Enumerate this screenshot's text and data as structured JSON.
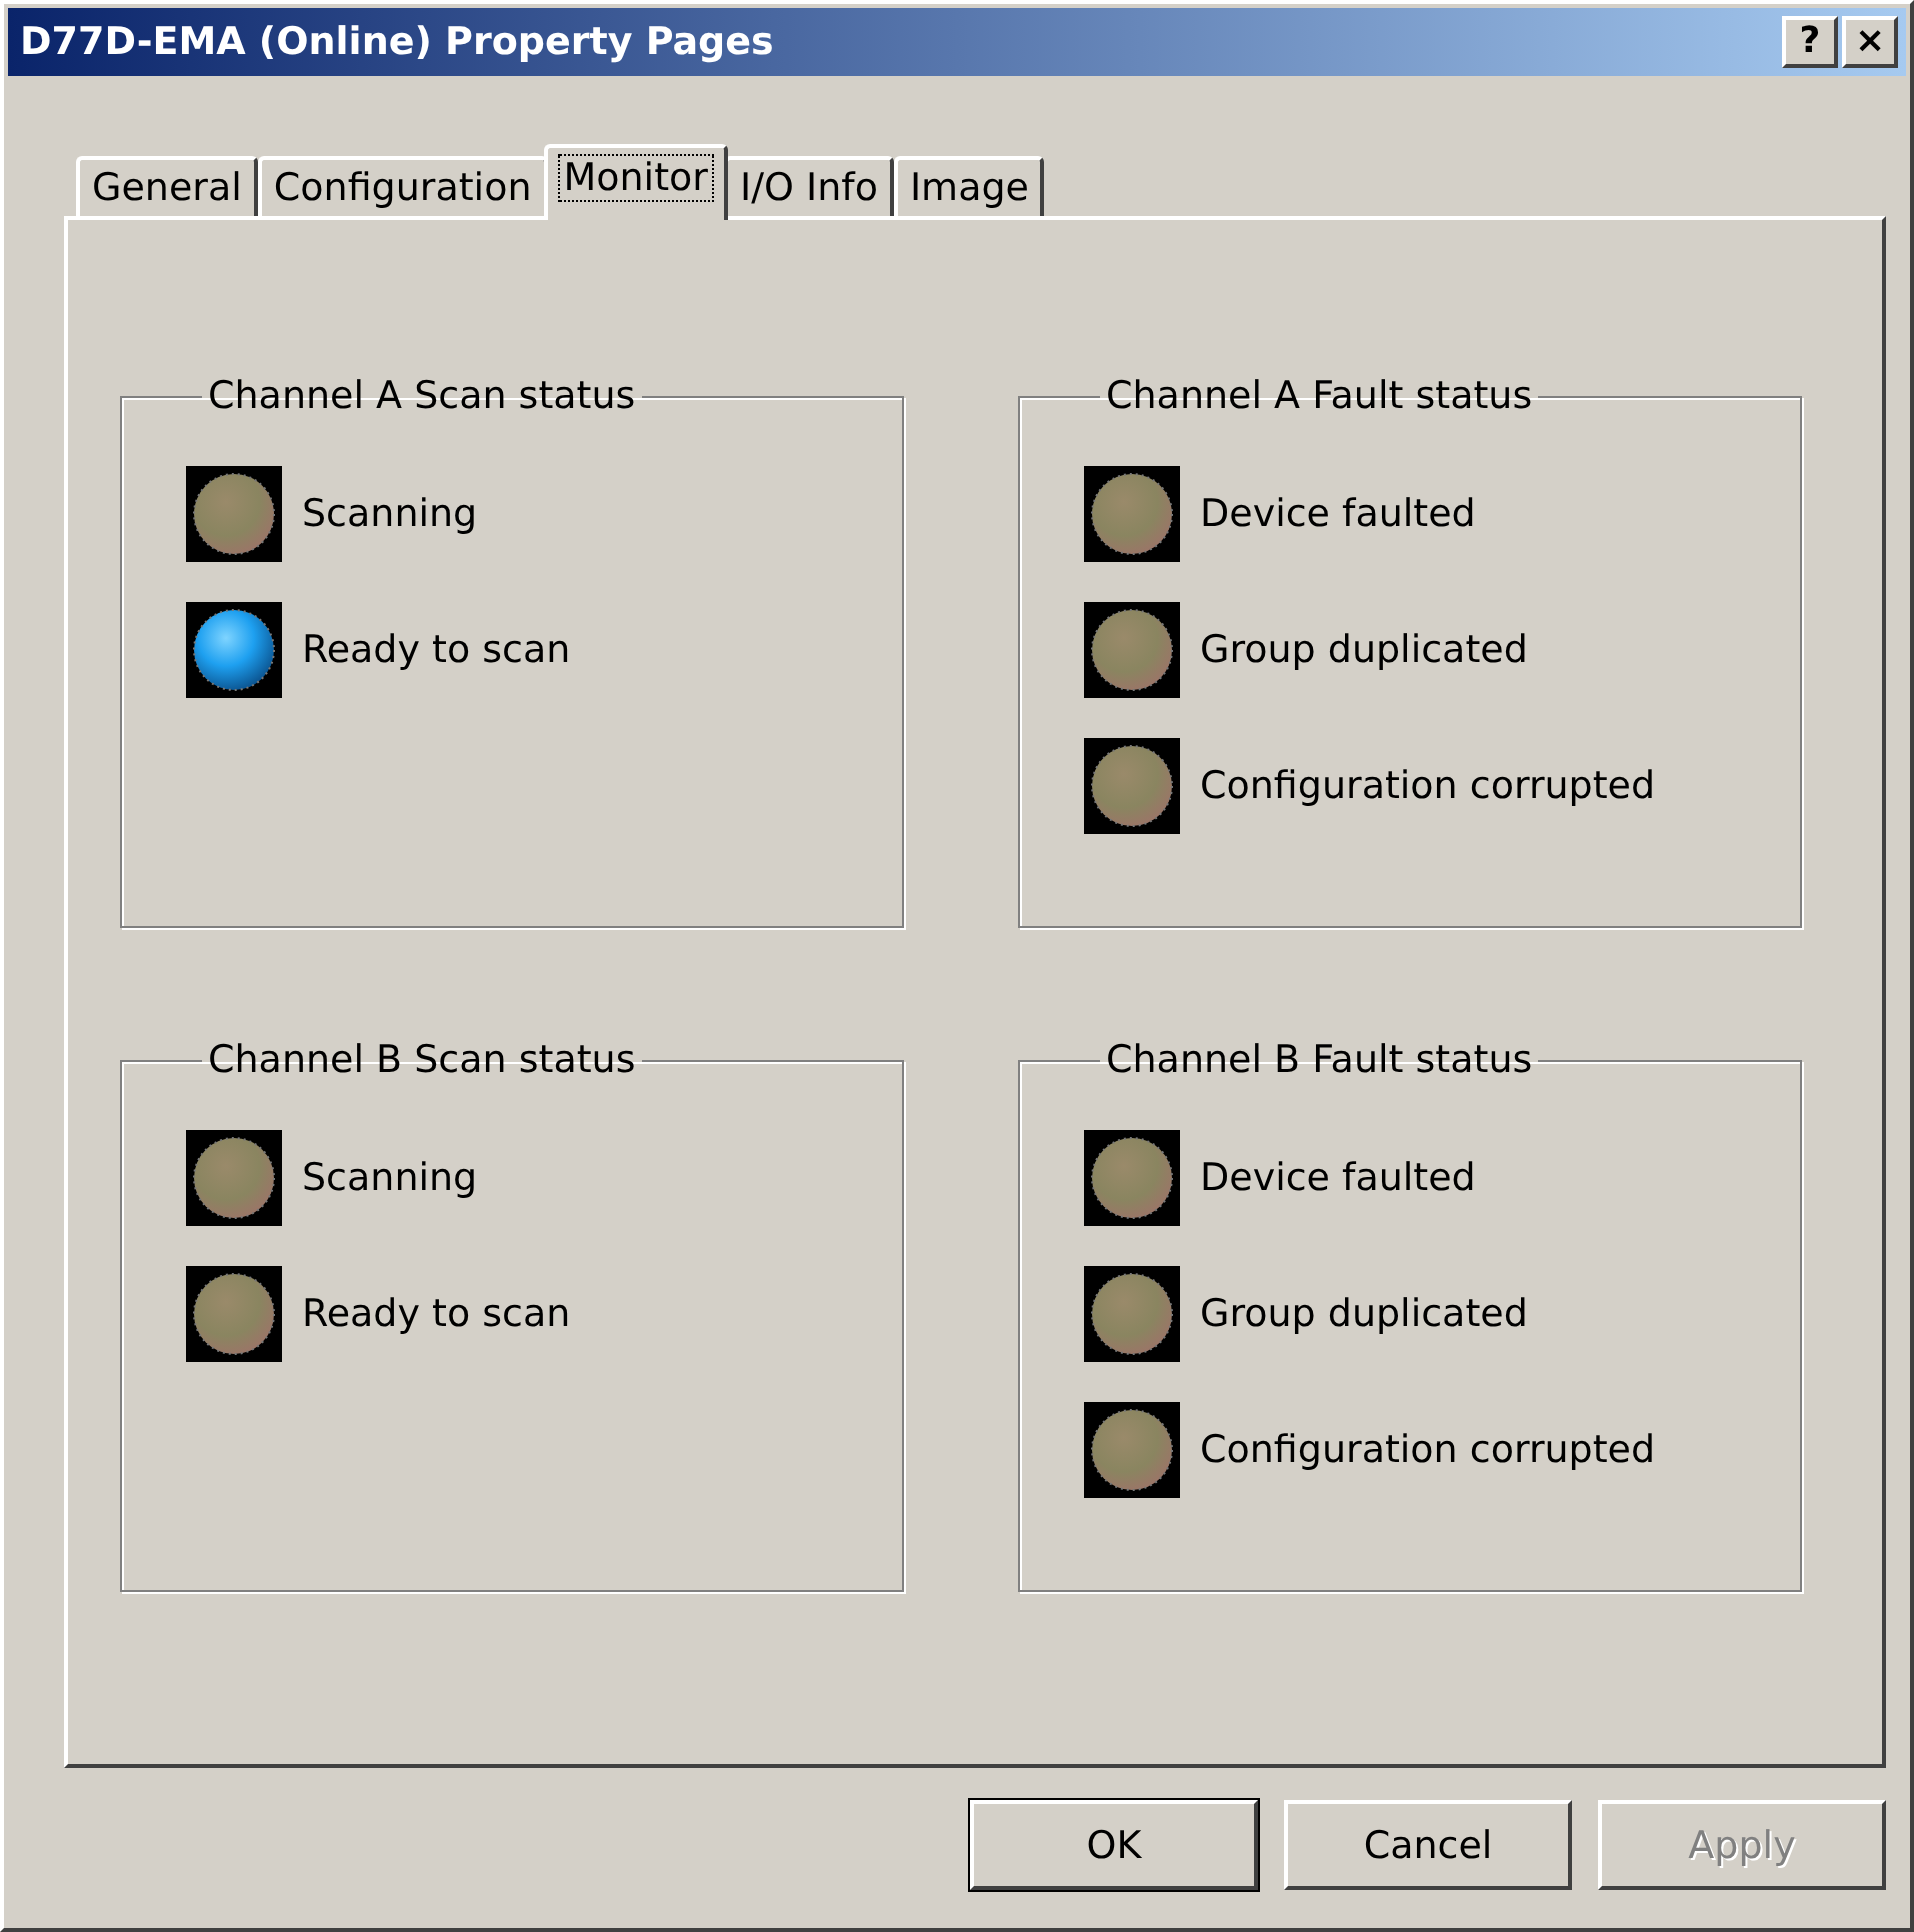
{
  "window": {
    "title": "D77D-EMA (Online) Property Pages",
    "help_button": "?",
    "close_button": "×"
  },
  "tabs": [
    {
      "label": "General",
      "selected": false
    },
    {
      "label": "Configuration",
      "selected": false
    },
    {
      "label": "Monitor",
      "selected": true
    },
    {
      "label": "I/O Info",
      "selected": false
    },
    {
      "label": "Image",
      "selected": false
    }
  ],
  "groups": [
    {
      "title": "Channel A Scan status",
      "indicators": [
        {
          "label": "Scanning",
          "on": false
        },
        {
          "label": "Ready to scan",
          "on": true
        }
      ]
    },
    {
      "title": "Channel A Fault status",
      "indicators": [
        {
          "label": "Device faulted",
          "on": false
        },
        {
          "label": "Group duplicated",
          "on": false
        },
        {
          "label": "Configuration corrupted",
          "on": false
        }
      ]
    },
    {
      "title": "Channel B Scan status",
      "indicators": [
        {
          "label": "Scanning",
          "on": false
        },
        {
          "label": "Ready to scan",
          "on": false
        }
      ]
    },
    {
      "title": "Channel B Fault status",
      "indicators": [
        {
          "label": "Device faulted",
          "on": false
        },
        {
          "label": "Group duplicated",
          "on": false
        },
        {
          "label": "Configuration corrupted",
          "on": false
        }
      ]
    }
  ],
  "buttons": [
    {
      "label": "OK",
      "default": true,
      "disabled": false
    },
    {
      "label": "Cancel",
      "default": false,
      "disabled": false
    },
    {
      "label": "Apply",
      "default": false,
      "disabled": true
    }
  ]
}
